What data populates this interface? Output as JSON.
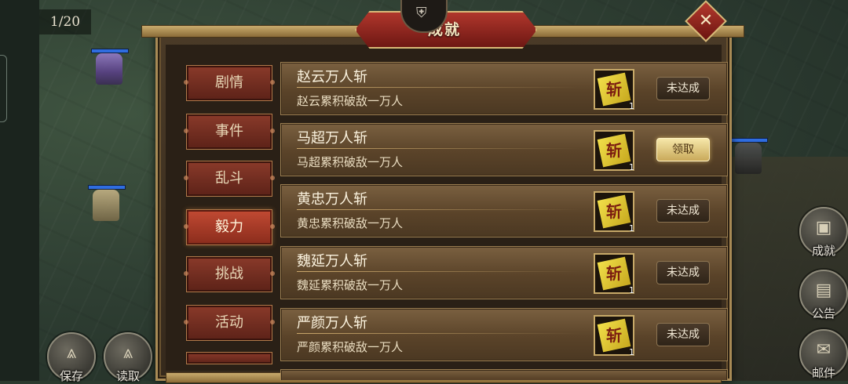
{
  "hud": {
    "counter": "1/20",
    "save_label": "保存",
    "load_label": "读取",
    "achievements_label": "成就",
    "notice_label": "公告",
    "mail_label": "邮件"
  },
  "dialog": {
    "title": "成就",
    "close_icon": "close-x-icon"
  },
  "categories": [
    {
      "label": "剧情",
      "active": false
    },
    {
      "label": "事件",
      "active": false
    },
    {
      "label": "乱斗",
      "active": false
    },
    {
      "label": "毅力",
      "active": true
    },
    {
      "label": "挑战",
      "active": false
    },
    {
      "label": "活动",
      "active": false
    }
  ],
  "achievements": [
    {
      "name": "赵云万人斩",
      "description": "赵云累积破敌一万人",
      "reward_glyph": "斩",
      "reward_qty": "1",
      "status": "未达成",
      "claimable": false
    },
    {
      "name": "马超万人斩",
      "description": "马超累积破敌一万人",
      "reward_glyph": "斩",
      "reward_qty": "1",
      "status": "领取",
      "claimable": true
    },
    {
      "name": "黄忠万人斩",
      "description": "黄忠累积破敌一万人",
      "reward_glyph": "斩",
      "reward_qty": "1",
      "status": "未达成",
      "claimable": false
    },
    {
      "name": "魏延万人斩",
      "description": "魏延累积破敌一万人",
      "reward_glyph": "斩",
      "reward_qty": "1",
      "status": "未达成",
      "claimable": false
    },
    {
      "name": "严颜万人斩",
      "description": "严颜累积破敌一万人",
      "reward_glyph": "斩",
      "reward_qty": "1",
      "status": "未达成",
      "claimable": false
    }
  ],
  "colors": {
    "accent_red": "#8a2c1c",
    "gold": "#c9ab6d",
    "claim_gold": "#f6e7a9"
  }
}
